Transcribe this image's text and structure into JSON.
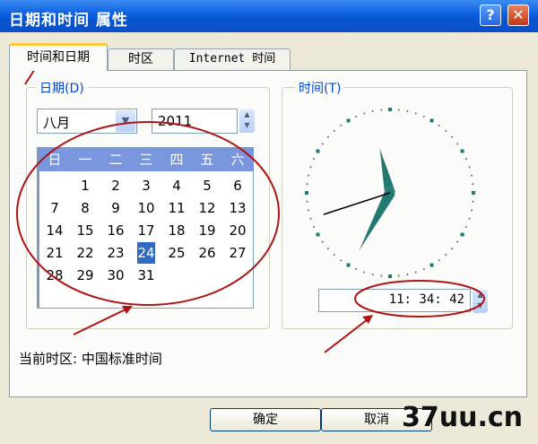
{
  "window": {
    "title": "日期和时间 属性",
    "help": "?",
    "close": "✕"
  },
  "tabs": [
    {
      "label": "时间和日期",
      "active": true
    },
    {
      "label": "时区",
      "active": false
    },
    {
      "label": "Internet 时间",
      "active": false
    }
  ],
  "date_group": {
    "title": "日期(D)",
    "month": "八月",
    "year": "2011",
    "weekdays": [
      "日",
      "一",
      "二",
      "三",
      "四",
      "五",
      "六"
    ],
    "weeks": [
      [
        "",
        "1",
        "2",
        "3",
        "4",
        "5",
        "6"
      ],
      [
        "7",
        "8",
        "9",
        "10",
        "11",
        "12",
        "13"
      ],
      [
        "14",
        "15",
        "16",
        "17",
        "18",
        "19",
        "20"
      ],
      [
        "21",
        "22",
        "23",
        "24",
        "25",
        "26",
        "27"
      ],
      [
        "28",
        "29",
        "30",
        "31",
        "",
        "",
        ""
      ]
    ],
    "selected_day": "24"
  },
  "time_group": {
    "title": "时间(T)",
    "time": "11: 34: 42",
    "hour": 11,
    "minute": 34,
    "second": 42
  },
  "timezone_label": "当前时区: 中国标准时间",
  "buttons": {
    "ok": "确定",
    "cancel": "取消"
  },
  "watermark": "37uu.cn",
  "colors": {
    "title_bar": "#0a5ee0",
    "calendar_header": "#7a96df",
    "selected": "#316ac5",
    "annotation": "#b01515",
    "hand": "#1f7a72"
  }
}
